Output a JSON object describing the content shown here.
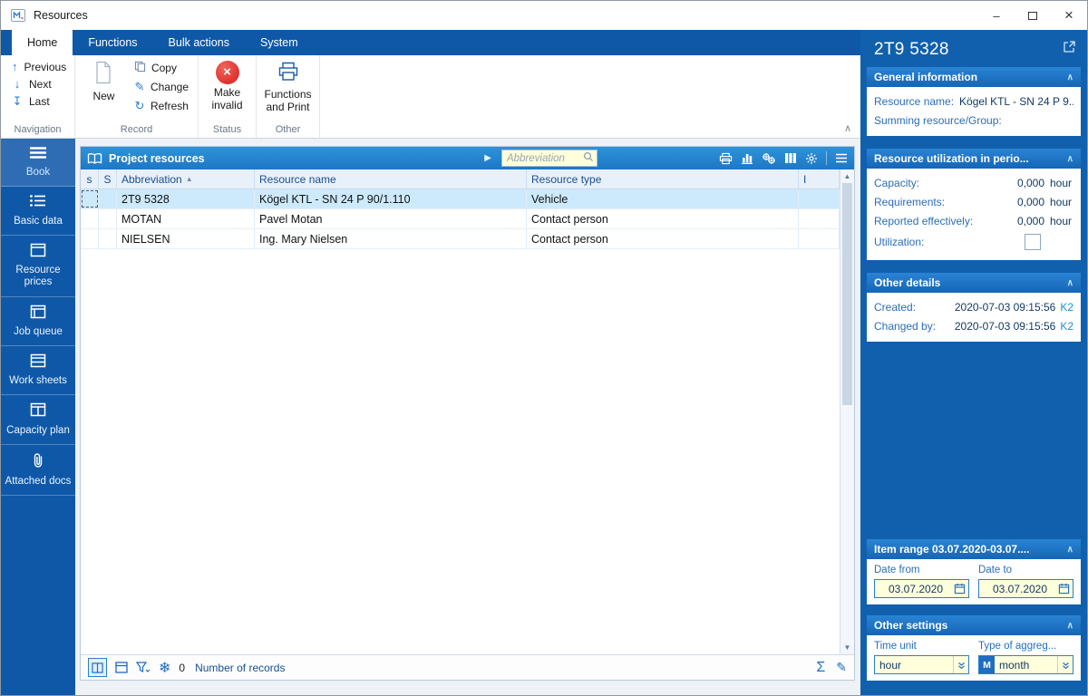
{
  "window": {
    "title": "Resources"
  },
  "icons": {
    "previous": "↑",
    "next": "↓",
    "last": "↧",
    "refresh": "↻",
    "pencil": "✎",
    "sigma": "Σ",
    "snowflake": "❄",
    "chevron_up": "∧",
    "sort_asc": "▲",
    "expand_arrow": "▶",
    "minimize": "–",
    "close": "×",
    "scroll_up": "▲",
    "scroll_down": "▼",
    "x_mark": "×"
  },
  "colors": {
    "primary": "#0f58a8",
    "accent": "#2a7fd0",
    "selection": "#cdeafc",
    "input_bg": "#ffffdc"
  },
  "ribbon": {
    "tabs": [
      {
        "label": "Home"
      },
      {
        "label": "Functions"
      },
      {
        "label": "Bulk actions"
      },
      {
        "label": "System"
      }
    ],
    "navigation": {
      "label": "Navigation",
      "items": [
        {
          "label": "Previous"
        },
        {
          "label": "Next"
        },
        {
          "label": "Last"
        }
      ]
    },
    "record": {
      "label": "Record",
      "new_label": "New",
      "items": [
        "Copy",
        "Change",
        "Refresh"
      ]
    },
    "status": {
      "label": "Status",
      "button": "Make invalid"
    },
    "other": {
      "label": "Other",
      "button": "Functions and Print"
    }
  },
  "sidebar": {
    "items": [
      {
        "label": "Book"
      },
      {
        "label": "Basic data"
      },
      {
        "label": "Resource prices"
      },
      {
        "label": "Job queue"
      },
      {
        "label": "Work sheets"
      },
      {
        "label": "Capacity plan"
      },
      {
        "label": "Attached docs"
      }
    ]
  },
  "table": {
    "title": "Project resources",
    "search_placeholder": "Abbreviation",
    "columns": [
      "s",
      "S",
      "Abbreviation",
      "Resource name",
      "Resource type",
      "I"
    ],
    "rows": [
      {
        "abbreviation": "2T9 5328",
        "resource_name": "Kögel KTL - SN 24 P 90/1.110",
        "resource_type": "Vehicle"
      },
      {
        "abbreviation": "MOTAN",
        "resource_name": "Pavel Motan",
        "resource_type": "Contact person"
      },
      {
        "abbreviation": "NIELSEN",
        "resource_name": "Ing. Mary Nielsen",
        "resource_type": "Contact person"
      }
    ],
    "footer": {
      "count": "0",
      "records_label": "Number of records"
    }
  },
  "detail": {
    "title": "2T9 5328",
    "general": {
      "header": "General information",
      "resource_name_label": "Resource name:",
      "resource_name_value": "Kögel KTL - SN 24 P 9...",
      "summing_label": "Summing resource/Group:"
    },
    "utilization": {
      "header": "Resource utilization in perio...",
      "rows": [
        {
          "label": "Capacity:",
          "value": "0,000",
          "unit": "hour"
        },
        {
          "label": "Requirements:",
          "value": "0,000",
          "unit": "hour"
        },
        {
          "label": "Reported effectively:",
          "value": "0,000",
          "unit": "hour"
        }
      ],
      "utilization_label": "Utilization:"
    },
    "other_details": {
      "header": "Other details",
      "rows": [
        {
          "label": "Created:",
          "value": "2020-07-03 09:15:56",
          "link": "K2"
        },
        {
          "label": "Changed by:",
          "value": "2020-07-03 09:15:56",
          "link": "K2"
        }
      ]
    },
    "item_range": {
      "header": "Item range 03.07.2020-03.07....",
      "date_from_label": "Date from",
      "date_from_value": "03.07.2020",
      "date_to_label": "Date to",
      "date_to_value": "03.07.2020"
    },
    "other_settings": {
      "header": "Other settings",
      "time_unit_label": "Time unit",
      "time_unit_value": "hour",
      "aggregation_label": "Type of aggreg...",
      "aggregation_badge": "M",
      "aggregation_value": "month"
    }
  }
}
